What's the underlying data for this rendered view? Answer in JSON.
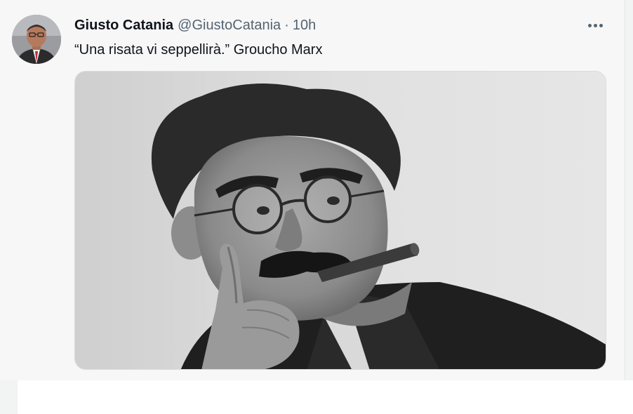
{
  "tweet": {
    "display_name": "Giusto Catania",
    "handle": "@GiustoCatania",
    "separator": "·",
    "time": "10h",
    "text": "“Una risata vi seppellirà.” Groucho Marx",
    "more_icon": "more-horizontal-icon",
    "media": {
      "type": "photo",
      "style": "black-and-white"
    }
  }
}
